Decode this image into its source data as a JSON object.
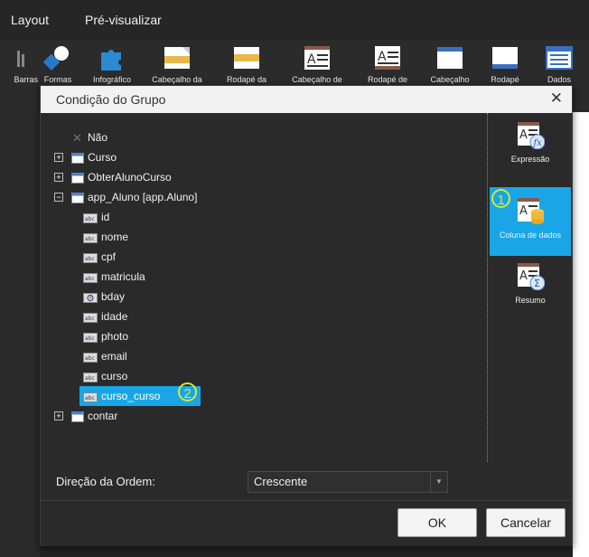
{
  "menu": {
    "items": [
      {
        "label": "Layout"
      },
      {
        "label": "Pré-visualizar"
      }
    ]
  },
  "ribbon": {
    "items": [
      {
        "label": "Barras"
      },
      {
        "label": "Formas"
      },
      {
        "label": "Infográfico"
      },
      {
        "label": "Cabeçalho da"
      },
      {
        "label": "Rodapé da"
      },
      {
        "label": "Cabeçalho de"
      },
      {
        "label": "Rodapé de"
      },
      {
        "label": "Cabeçalho"
      },
      {
        "label": "Rodapé"
      },
      {
        "label": "Dados"
      }
    ]
  },
  "dialog": {
    "title": "Condição do Grupo",
    "tree": [
      {
        "label": "Não"
      },
      {
        "label": "Curso"
      },
      {
        "label": "ObterAlunoCurso"
      },
      {
        "label": "app_Aluno [app.Aluno]"
      },
      {
        "label": "id"
      },
      {
        "label": "nome"
      },
      {
        "label": "cpf"
      },
      {
        "label": "matricula"
      },
      {
        "label": "bday"
      },
      {
        "label": "idade"
      },
      {
        "label": "photo"
      },
      {
        "label": "email"
      },
      {
        "label": "curso"
      },
      {
        "label": "curso_curso"
      },
      {
        "label": "contar"
      }
    ],
    "side": [
      {
        "label": "Expressão"
      },
      {
        "label": "Coluna de dados"
      },
      {
        "label": "Resumo"
      }
    ],
    "order": {
      "label": "Direção da Ordem:",
      "value": "Crescente"
    },
    "buttons": {
      "ok": "OK",
      "cancel": "Cancelar"
    },
    "markers": {
      "one": "1",
      "two": "2"
    }
  }
}
